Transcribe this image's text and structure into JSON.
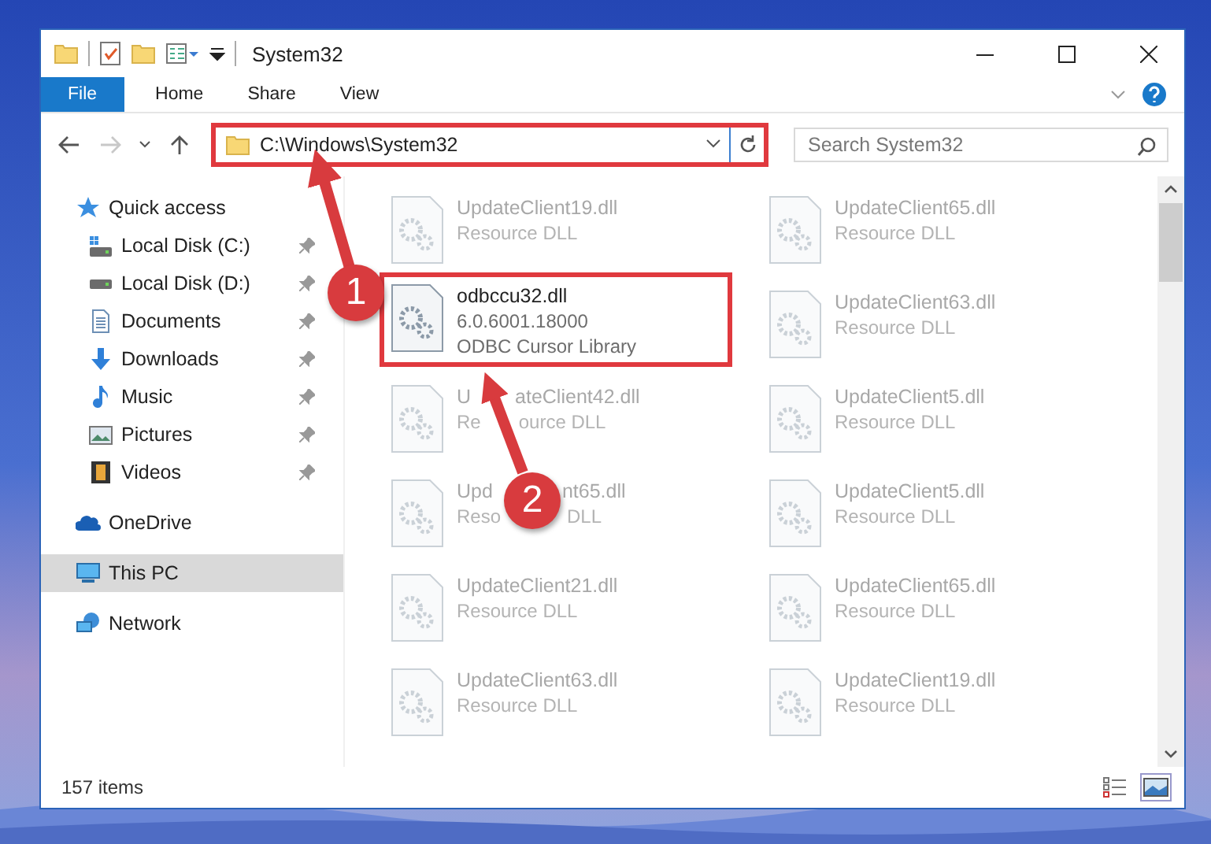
{
  "window": {
    "title": "System32",
    "controls": [
      {
        "kind": "minimize"
      },
      {
        "kind": "maximize"
      },
      {
        "kind": "close"
      }
    ]
  },
  "ribbon": {
    "tabs": [
      {
        "label": "File",
        "kind": "menu"
      },
      {
        "label": "Home",
        "kind": "tab",
        "selected": false
      },
      {
        "label": "Share",
        "kind": "tab",
        "selected": false
      },
      {
        "label": "View",
        "kind": "tab",
        "selected": false
      }
    ]
  },
  "navigation": {
    "forward_disabled": true
  },
  "address": {
    "path": "C:\\Windows\\System32",
    "highlighted": true
  },
  "search": {
    "placeholder": "Search System32"
  },
  "sidebar": {
    "items": [
      {
        "label": "Quick access",
        "kind": "star",
        "selected": false,
        "children": [
          {
            "label": "Local Disk (C:)",
            "kind": "system-drive",
            "pinned": true,
            "selected": false
          },
          {
            "label": "Local Disk (D:)",
            "kind": "drive",
            "pinned": true,
            "selected": false
          },
          {
            "label": "Documents",
            "kind": "document",
            "pinned": true,
            "selected": false
          },
          {
            "label": "Downloads",
            "kind": "download",
            "pinned": true,
            "selected": false
          },
          {
            "label": "Music",
            "kind": "music",
            "pinned": true,
            "selected": false
          },
          {
            "label": "Pictures",
            "kind": "pictures",
            "pinned": true,
            "selected": false
          },
          {
            "label": "Videos",
            "kind": "videos",
            "pinned": true,
            "selected": false
          }
        ]
      },
      {
        "label": "OneDrive",
        "kind": "cloud",
        "selected": false
      },
      {
        "label": "This PC",
        "kind": "computer",
        "selected": true
      },
      {
        "label": "Network",
        "kind": "network",
        "selected": false
      }
    ]
  },
  "files": [
    {
      "name": "UpdateClient19.dll",
      "details": [
        "Resource DLL"
      ],
      "blurred": true,
      "highlighted": false
    },
    {
      "name": "UpdateClient65.dll",
      "details": [
        "Resource DLL"
      ],
      "blurred": true,
      "highlighted": false
    },
    {
      "name": "odbccu32.dll",
      "details": [
        "6.0.6001.18000",
        "ODBC Cursor Library"
      ],
      "blurred": false,
      "highlighted": true
    },
    {
      "name": "UpdateClient63.dll",
      "details": [
        "Resource DLL"
      ],
      "blurred": true,
      "highlighted": false
    },
    {
      "name": [
        "U",
        "ateClient42.dll"
      ],
      "details": [
        [
          "Re",
          "ource DLL"
        ]
      ],
      "blurred": true,
      "highlighted": false
    },
    {
      "name": "UpdateClient5.dll",
      "details": [
        "Resource DLL"
      ],
      "blurred": true,
      "highlighted": false
    },
    {
      "name": [
        "Upd",
        "nt65.dll"
      ],
      "details": [
        [
          "Reso",
          "DLL"
        ]
      ],
      "blurred": true,
      "highlighted": false
    },
    {
      "name": "UpdateClient5.dll",
      "details": [
        "Resource DLL"
      ],
      "blurred": true,
      "highlighted": false
    },
    {
      "name": "UpdateClient21.dll",
      "details": [
        "Resource DLL"
      ],
      "blurred": true,
      "highlighted": false
    },
    {
      "name": "UpdateClient65.dll",
      "details": [
        "Resource DLL"
      ],
      "blurred": true,
      "highlighted": false
    },
    {
      "name": "UpdateClient63.dll",
      "details": [
        "Resource DLL"
      ],
      "blurred": true,
      "highlighted": false
    },
    {
      "name": "UpdateClient19.dll",
      "details": [
        "Resource DLL"
      ],
      "blurred": true,
      "highlighted": false
    }
  ],
  "status_bar": {
    "count": "157 items",
    "views": [
      {
        "kind": "details",
        "selected": false
      },
      {
        "kind": "tiles",
        "selected": true
      }
    ]
  },
  "annotations": [
    {
      "label": "1"
    },
    {
      "label": "2"
    }
  ]
}
